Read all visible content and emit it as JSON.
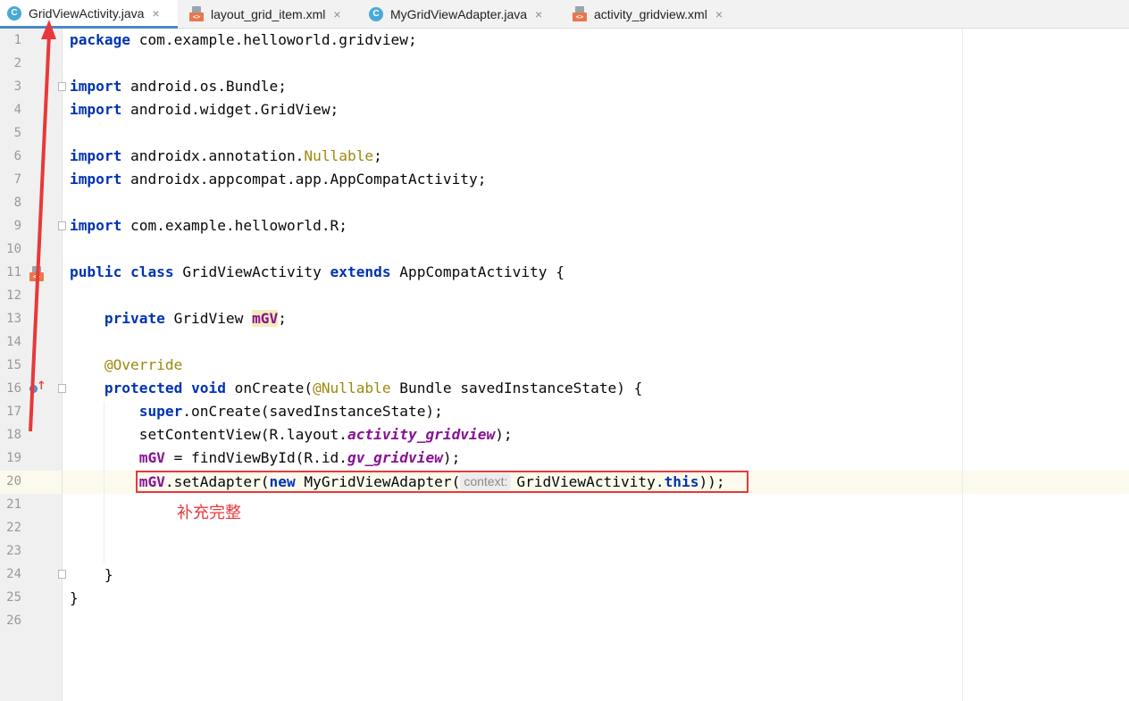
{
  "tabs": [
    {
      "label": "GridViewActivity.java",
      "icon": "class-icon",
      "icon_glyph": "C",
      "active": true
    },
    {
      "label": "layout_grid_item.xml",
      "icon": "xml-file-icon",
      "icon_glyph": "<>"
    },
    {
      "label": "MyGridViewAdapter.java",
      "icon": "class-icon",
      "icon_glyph": "C"
    },
    {
      "label": "activity_gridview.xml",
      "icon": "xml-file-icon",
      "icon_glyph": "<>"
    }
  ],
  "tab_close_glyph": "×",
  "line_numbers": [
    "1",
    "2",
    "3",
    "4",
    "5",
    "6",
    "7",
    "8",
    "9",
    "10",
    "11",
    "12",
    "13",
    "14",
    "15",
    "16",
    "17",
    "18",
    "19",
    "20",
    "21",
    "22",
    "23",
    "24",
    "25",
    "26"
  ],
  "code": {
    "l1": {
      "kw": "package",
      "rest": " com.example.helloworld.gridview;"
    },
    "l3": {
      "kw": "import",
      "rest": " android.os.Bundle;"
    },
    "l4": {
      "kw": "import",
      "rest": " android.widget.GridView;"
    },
    "l6": {
      "kw": "import",
      "pre": " androidx.annotation.",
      "ann": "Nullable",
      "post": ";"
    },
    "l7": {
      "kw": "import",
      "rest": " androidx.appcompat.app.AppCompatActivity;"
    },
    "l9": {
      "kw": "import",
      "rest": " com.example.helloworld.R;"
    },
    "l11": {
      "kw1": "public",
      "kw2": "class",
      "name": " GridViewActivity ",
      "kw3": "extends",
      "rest": " AppCompatActivity {"
    },
    "l13": {
      "indent": "    ",
      "kw": "private",
      "type": " GridView ",
      "field": "mGV",
      "post": ";"
    },
    "l15": {
      "indent": "    ",
      "ann": "@Override"
    },
    "l16": {
      "indent": "    ",
      "kw1": "protected",
      "kw2": "void",
      "pre": " onCreate(",
      "ann": "@Nullable",
      "rest": " Bundle savedInstanceState) {"
    },
    "l17": {
      "indent": "        ",
      "kw": "super",
      "rest": ".onCreate(savedInstanceState);"
    },
    "l18": {
      "indent": "        ",
      "pre": "setContentView(R.layout.",
      "stat": "activity_gridview",
      "post": ");"
    },
    "l19": {
      "indent": "        ",
      "field": "mGV",
      "pre": " = findViewById(R.id.",
      "stat": "gv_gridview",
      "post": ");"
    },
    "l20": {
      "indent": "        ",
      "field": "mGV",
      "pre": ".setAdapter(",
      "kw": "new",
      "mid": " MyGridViewAdapter(",
      "hint": "context:",
      "arg": "GridViewActivity.",
      "kw2": "this",
      "post": "));"
    },
    "l24": {
      "indent": "    ",
      "rest": "}"
    },
    "l25": {
      "rest": "}"
    }
  },
  "annotation_note": "补充完整",
  "colors": {
    "keyword": "#0033b3",
    "annotation": "#9e880d",
    "field": "#871094",
    "highlight_red": "#e8383b",
    "current_line": "#fcfaed"
  }
}
